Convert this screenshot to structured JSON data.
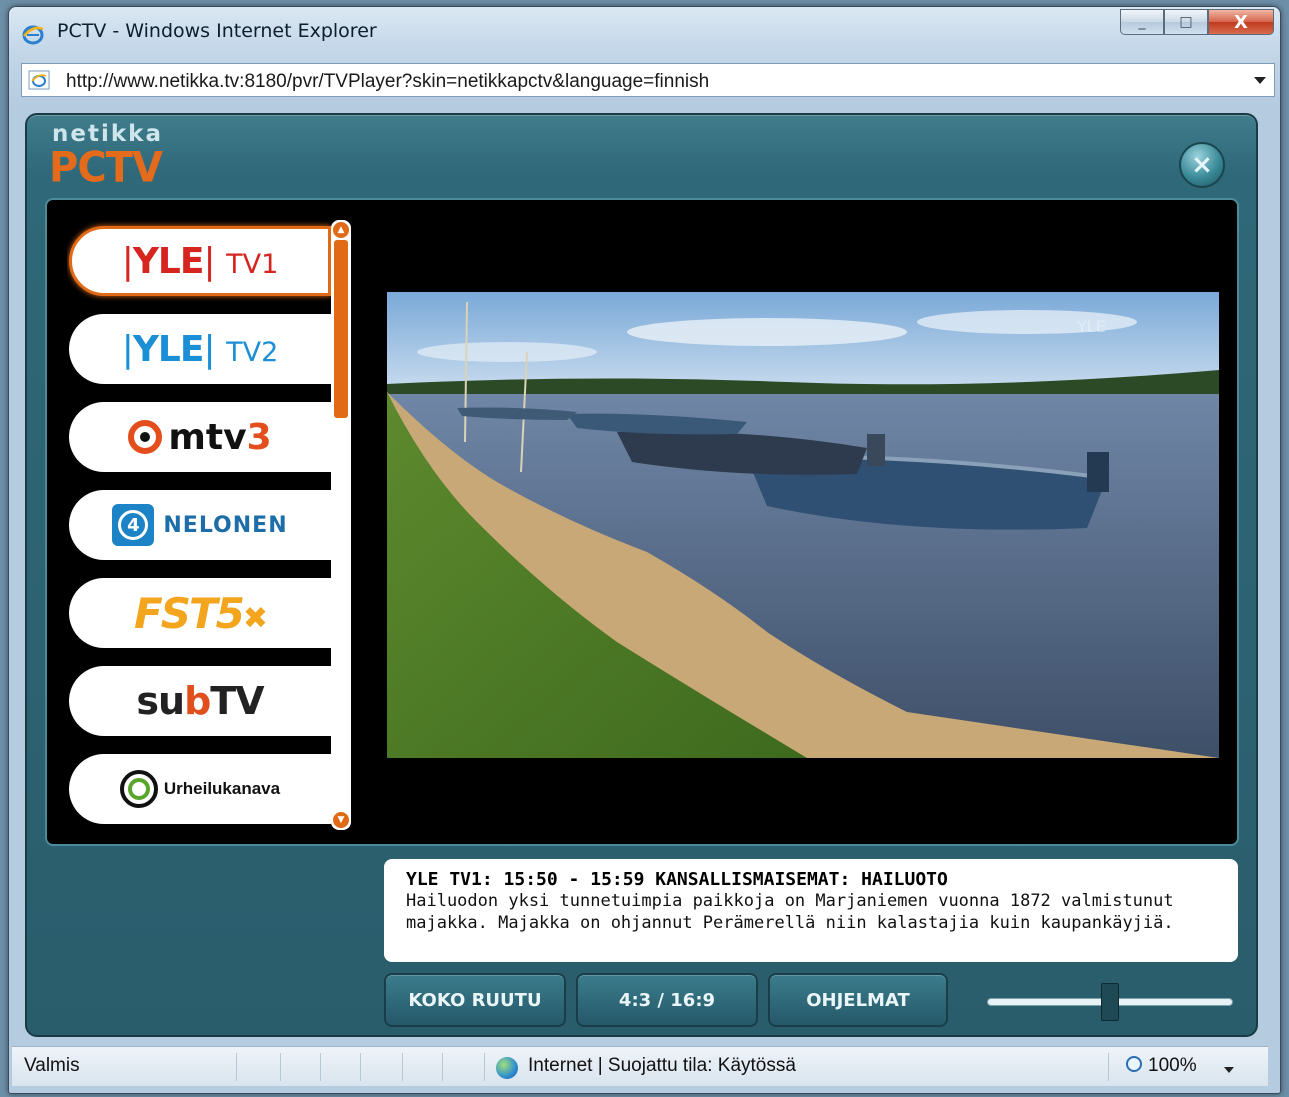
{
  "window": {
    "title": "PCTV - Windows Internet Explorer",
    "address": "http://www.netikka.tv:8180/pvr/TVPlayer?skin=netikkapctv&language=finnish",
    "minimize_label": "_",
    "maximize_label": "□",
    "close_label": "X"
  },
  "player": {
    "logo_top": "netikka",
    "logo_bottom": "PCTV",
    "close_label": "×",
    "channels": [
      {
        "name": "YLE TV1",
        "brand": "YLE",
        "suffix": "TV1",
        "selected": true
      },
      {
        "name": "YLE TV2",
        "brand": "YLE",
        "suffix": "TV2",
        "selected": false
      },
      {
        "name": "MTV3",
        "brand": "mtv",
        "suffix": "3",
        "selected": false
      },
      {
        "name": "NELONEN",
        "brand": "NELONEN",
        "suffix": "4",
        "selected": false
      },
      {
        "name": "FST5",
        "brand": "FST5",
        "suffix": "✖",
        "selected": false
      },
      {
        "name": "subTV",
        "brand": "su",
        "mid": "b",
        "suffix": "TV",
        "selected": false
      },
      {
        "name": "Urheilukanava",
        "brand": "Urheilukanava",
        "selected": false
      }
    ],
    "program": {
      "title": "YLE TV1: 15:50 - 15:59 KANSALLISMAISEMAT: HAILUOTO",
      "description_line1": "Hailuodon yksi tunnetuimpia paikkoja on Marjaniemen vuonna 1872 valmistunut",
      "description_line2": "majakka. Majakka on ohjannut Perämerellä niin kalastajia kuin kaupankäyjiä."
    },
    "buttons": {
      "fullscreen": "KOKO RUUTU",
      "aspect": "4:3 / 16:9",
      "programs": "OHJELMAT"
    },
    "volume_level": 0.5
  },
  "status": {
    "ready": "Valmis",
    "zone": "Internet | Suojattu tila: Käytössä",
    "zoom": "100%"
  },
  "colors": {
    "accent": "#e06a16",
    "player_bg": "#2f6878"
  }
}
